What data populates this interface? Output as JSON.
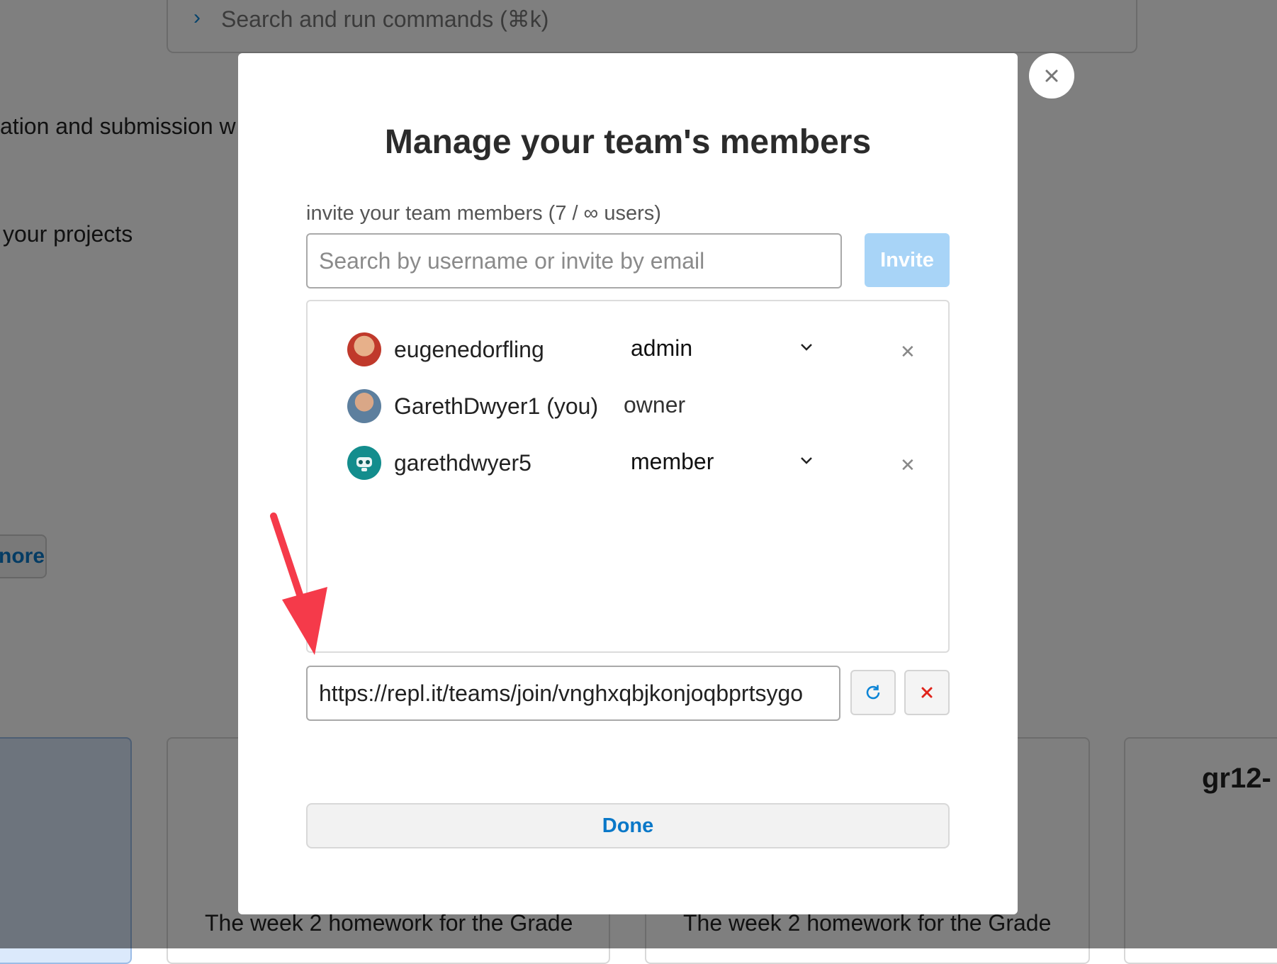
{
  "background": {
    "command_bar_placeholder": "Search and run commands (⌘k)",
    "text_line_1": "ation and submission w",
    "text_line_2": "your projects",
    "more_button": "nore",
    "card_description": "The week 2 homework for the Grade",
    "card_title_partial": "gr12-"
  },
  "modal": {
    "title": "Manage your team's members",
    "invite_label": "invite your team members (7 / ∞ users)",
    "search_placeholder": "Search by username or invite by email",
    "invite_button": "Invite",
    "members": [
      {
        "name": "eugenedorfling",
        "role": "admin",
        "editable": true,
        "avatar_color": "#c0392b"
      },
      {
        "name": "GarethDwyer1 (you)",
        "role": "owner",
        "editable": false,
        "avatar_color": "#5d7f9e"
      },
      {
        "name": "garethdwyer5",
        "role": "member",
        "editable": true,
        "avatar_color": "#138d8d"
      }
    ],
    "invite_link": "https://repl.it/teams/join/vnghxqbjkonjoqbprtsygo",
    "done_button": "Done"
  },
  "colors": {
    "accent": "#0a78c8",
    "invite_disabled": "#a8d4f7",
    "danger": "#e0241b",
    "annotation_arrow": "#f53a4a"
  }
}
